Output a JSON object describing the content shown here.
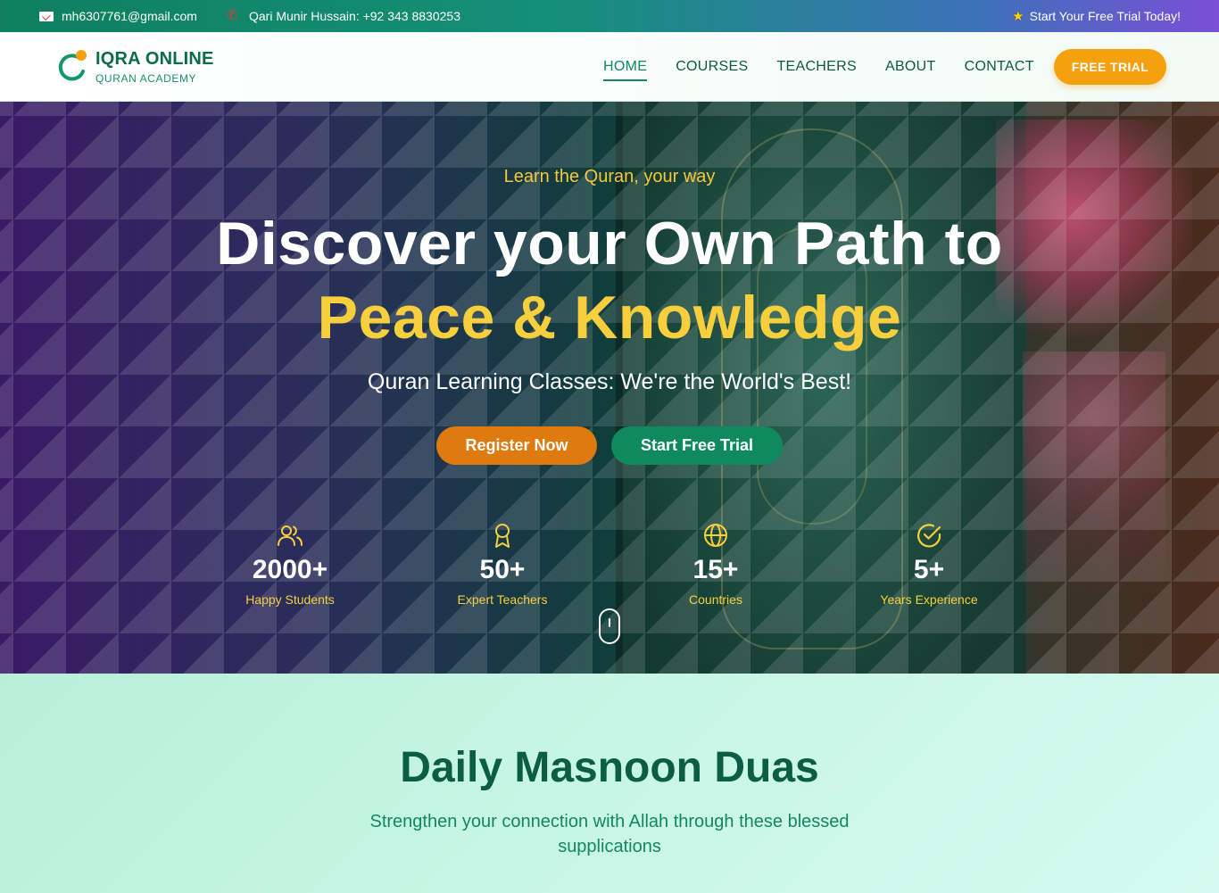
{
  "topbar": {
    "email": "mh6307761@gmail.com",
    "phone": "Qari Munir Hussain: +92 343 8830253",
    "trial_text": "Start Your Free Trial Today!"
  },
  "brand": {
    "title": "IQRA ONLINE",
    "subtitle": "QURAN ACADEMY",
    "primary_color": "#0c6b4a",
    "accent_color": "#f5a10f"
  },
  "nav": {
    "items": [
      {
        "label": "HOME",
        "active": true
      },
      {
        "label": "COURSES",
        "active": false
      },
      {
        "label": "TEACHERS",
        "active": false
      },
      {
        "label": "ABOUT",
        "active": false
      },
      {
        "label": "CONTACT",
        "active": false
      }
    ],
    "cta_label": "FREE TRIAL"
  },
  "hero": {
    "tagline": "Learn the Quran, your way",
    "headline_line1": "Discover your Own Path to",
    "headline_line2": "Peace & Knowledge",
    "subheadline": "Quran Learning Classes: We're the World's Best!",
    "register_label": "Register Now",
    "trial_label": "Start Free Trial",
    "stats": [
      {
        "icon": "users-icon",
        "value": "2000+",
        "label": "Happy Students"
      },
      {
        "icon": "award-icon",
        "value": "50+",
        "label": "Expert Teachers"
      },
      {
        "icon": "globe-icon",
        "value": "15+",
        "label": "Countries"
      },
      {
        "icon": "check-circle-icon",
        "value": "5+",
        "label": "Years Experience"
      }
    ]
  },
  "duas": {
    "title": "Daily Masnoon Duas",
    "subtitle": "Strengthen your connection with Allah through these blessed supplications"
  }
}
